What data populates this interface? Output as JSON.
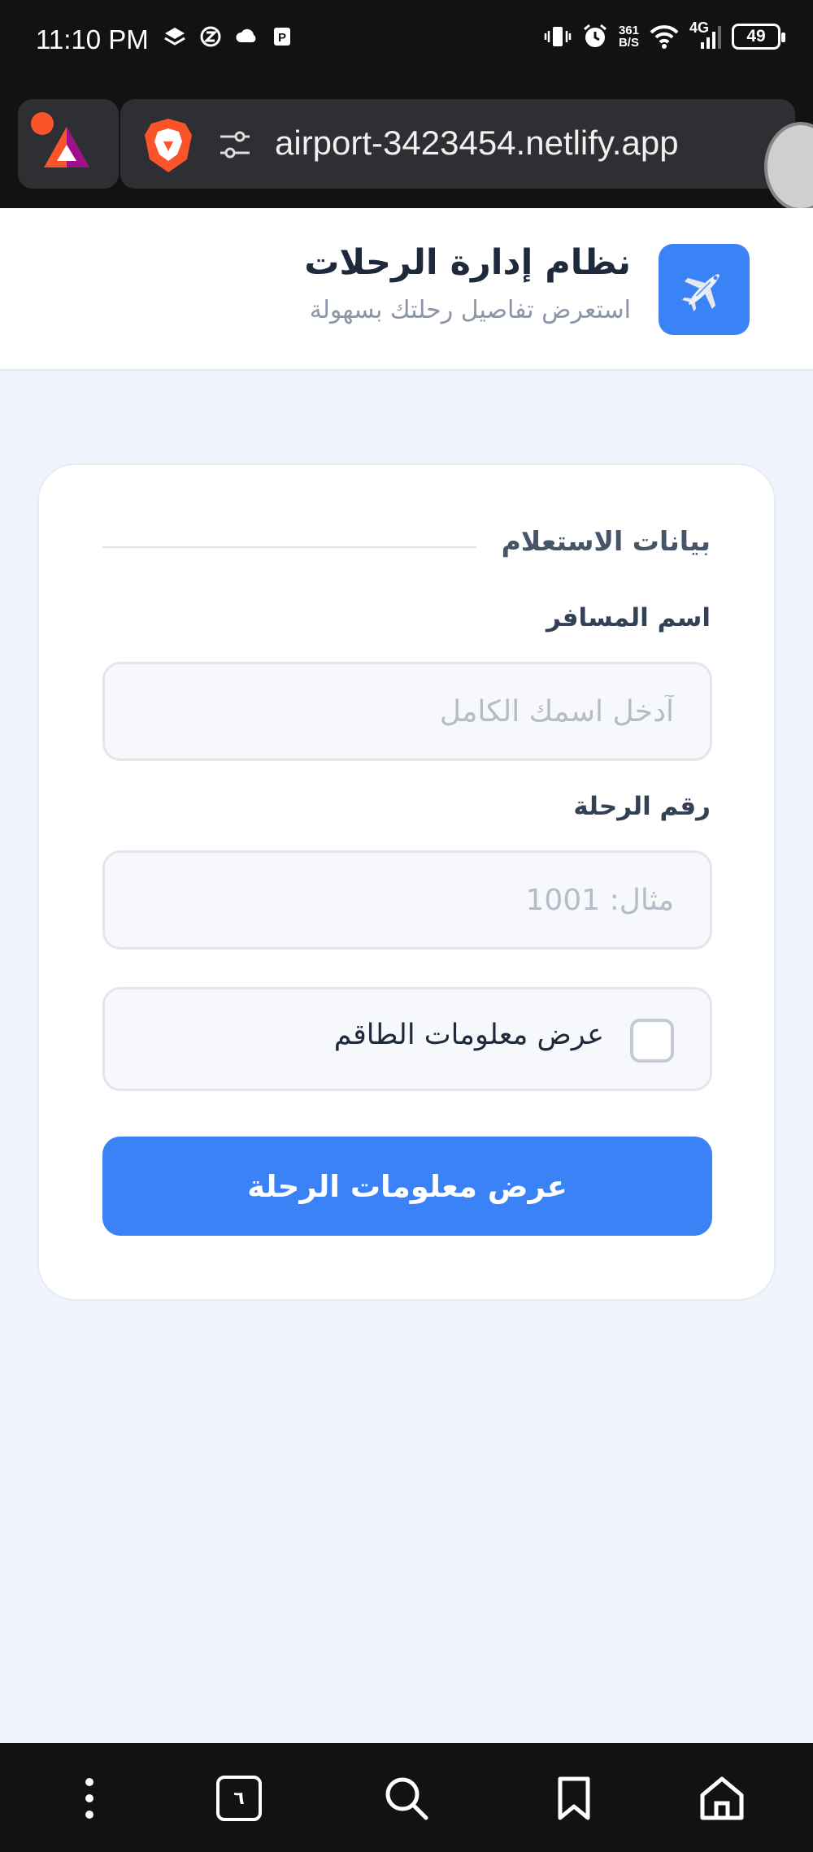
{
  "status_bar": {
    "time": "11:10 PM",
    "net_speed_value": "361",
    "net_speed_unit": "B/S",
    "network_type": "4G",
    "battery": "49"
  },
  "browser": {
    "url": "airport-3423454.netlify.app",
    "tab_count": "٦"
  },
  "app": {
    "title": "نظام إدارة الرحلات",
    "subtitle": "استعرض تفاصيل رحلتك بسهولة",
    "logo_icon": "airplane-icon"
  },
  "form": {
    "section_title": "بيانات الاستعلام",
    "passenger_label": "اسم المسافر",
    "passenger_placeholder": "آدخل اسمك الكامل",
    "passenger_value": "",
    "flight_label": "رقم الرحلة",
    "flight_placeholder": "مثال: 1001",
    "flight_value": "",
    "crew_checkbox_label": "عرض معلومات الطاقم",
    "crew_checked": false,
    "submit_label": "عرض معلومات الرحلة"
  },
  "colors": {
    "accent": "#3b82f6",
    "background": "#eef3fc",
    "brave_orange": "#fb542b"
  }
}
